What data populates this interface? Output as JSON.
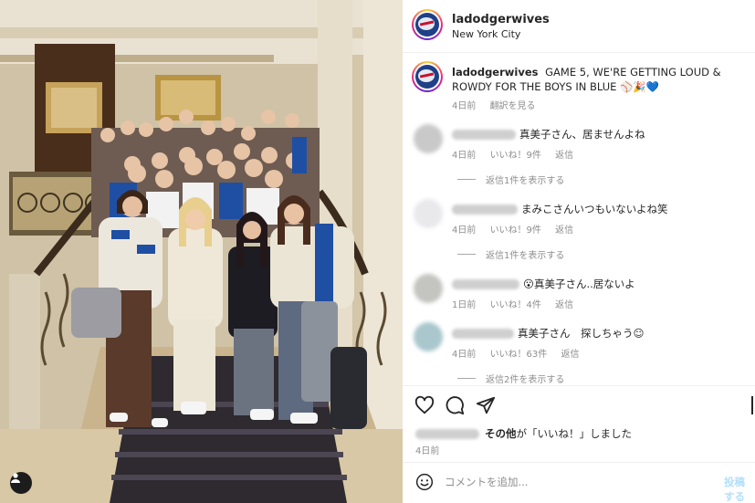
{
  "post": {
    "username": "ladodgerwives",
    "location": "New York City",
    "caption_text": "GAME 5, WE'RE GETTING LOUD & ROWDY FOR THE BOYS IN BLUE ⚾🎉💙",
    "caption_time": "4日前",
    "translate_label": "翻訳を見る"
  },
  "comments": [
    {
      "text": "真美子さん、居ませんよね",
      "time": "4日前",
      "likes": "いいね！9件",
      "reply": "返信",
      "view_replies": "返信1件を表示する",
      "avatar_color": "#c9c9c9"
    },
    {
      "text": "まみこさんいつもいないよね笑",
      "time": "4日前",
      "likes": "いいね！9件",
      "reply": "返信",
      "view_replies": "返信1件を表示する",
      "avatar_color": "#e9e9ec"
    },
    {
      "text": "😮真美子さん..居ないよ",
      "time": "1日前",
      "likes": "いいね！4件",
      "reply": "返信",
      "view_replies": "",
      "avatar_color": "#c4c4c0"
    },
    {
      "text": "真美子さん　探しちゃう☺",
      "time": "4日前",
      "likes": "いいね！63件",
      "reply": "返信",
      "view_replies": "返信2件を表示する",
      "avatar_color": "#a9c7cc"
    }
  ],
  "actions": {
    "like_icon": "heart-icon",
    "comment_icon": "comment-icon",
    "share_icon": "share-icon",
    "likes_suffix": "その他",
    "likes_text": "が「いいね！」しました",
    "date": "4日前"
  },
  "comment_box": {
    "placeholder": "コメントを追加...",
    "post_label": "投稿する",
    "emoji_icon": "emoji-icon"
  },
  "colors": {
    "link": "#b2dffc",
    "muted": "#8e8e8e",
    "text": "#262626",
    "dodger_blue": "#1f4fa3"
  }
}
